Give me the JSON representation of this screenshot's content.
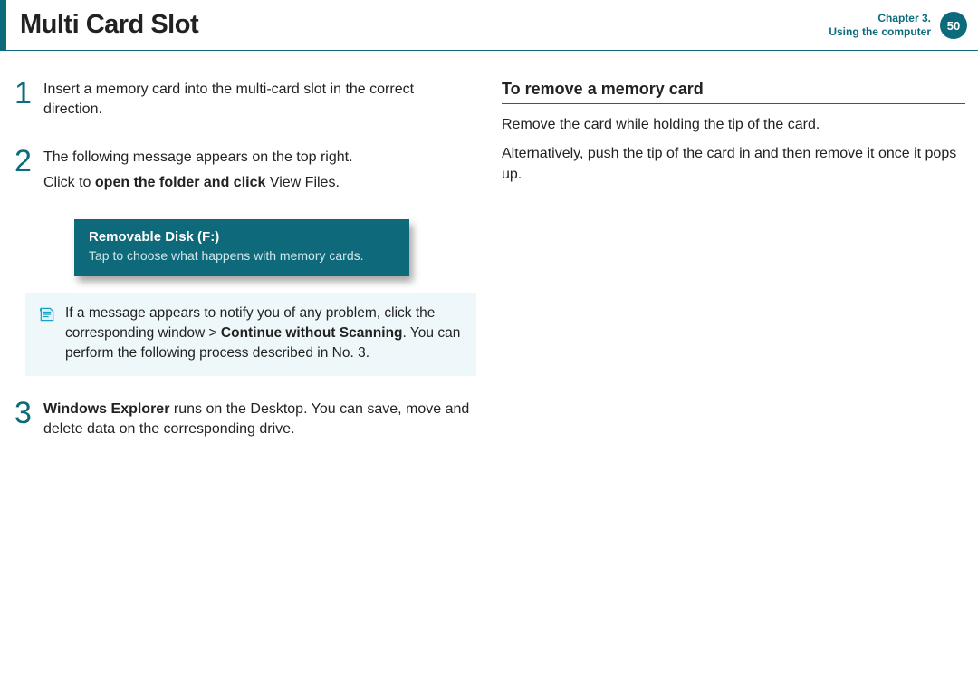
{
  "header": {
    "title": "Multi Card Slot",
    "chapter_line1": "Chapter 3.",
    "chapter_line2": "Using the computer",
    "page_number": "50"
  },
  "left": {
    "steps": [
      {
        "num": "1",
        "text": "Insert a memory card into the multi-card slot in the correct direction."
      },
      {
        "num": "2",
        "line1": "The following message appears on the top right.",
        "line2_pre": "Click to ",
        "line2_bold": "open the folder and click",
        "line2_post": " View Files."
      },
      {
        "num": "3",
        "bold": "Windows Explorer",
        "text": " runs on the Desktop. You can save, move and delete data on the corresponding drive."
      }
    ],
    "toast": {
      "title": "Removable Disk (F:)",
      "body": "Tap to choose what happens with memory cards."
    },
    "note": {
      "pre": "If a message appears to notify you of any problem, click the corresponding window > ",
      "bold": "Continue without Scanning",
      "post": ". You can perform the following process described in No. 3."
    }
  },
  "right": {
    "subhead": "To remove a memory card",
    "para1": "Remove the card while holding the tip of the card.",
    "para2": "Alternatively, push the tip of the card in and then remove it once it pops up."
  }
}
